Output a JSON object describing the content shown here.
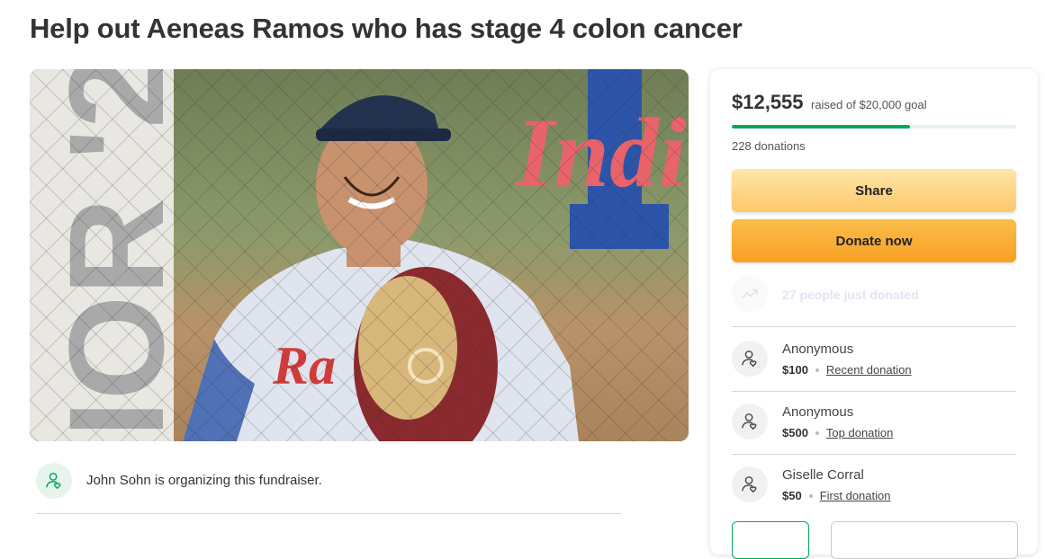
{
  "page": {
    "title": "Help out Aeneas Ramos who has stage 4 colon cancer"
  },
  "organizer": {
    "text": "John Sohn is organizing this fundraiser.",
    "icon": "user-heart-icon"
  },
  "sidebar": {
    "raised": "$12,555",
    "goal_text": "raised of $20,000 goal",
    "progress_fraction": 0.628,
    "donations_count": "228 donations",
    "share_label": "Share",
    "donate_label": "Donate now",
    "trend_text": "27 people just donated",
    "trend_icon": "trending-up-icon",
    "donors": [
      {
        "name": "Anonymous",
        "amount": "$100",
        "label": "Recent donation",
        "icon": "user-heart-icon"
      },
      {
        "name": "Anonymous",
        "amount": "$500",
        "label": "Top donation",
        "icon": "user-heart-icon"
      },
      {
        "name": "Giselle Corral",
        "amount": "$50",
        "label": "First donation",
        "icon": "user-heart-icon"
      }
    ]
  },
  "colors": {
    "progress": "#02a95c",
    "share_button": "#fdd47f",
    "donate_button": "#f9ad36"
  }
}
